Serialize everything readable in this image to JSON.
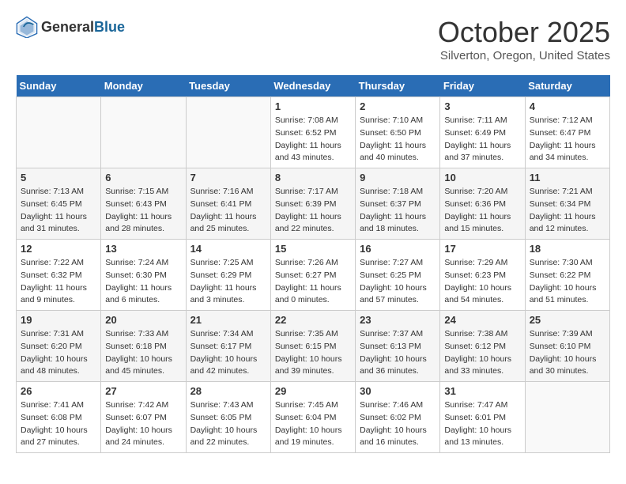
{
  "header": {
    "logo_general": "General",
    "logo_blue": "Blue",
    "title": "October 2025",
    "subtitle": "Silverton, Oregon, United States"
  },
  "days_of_week": [
    "Sunday",
    "Monday",
    "Tuesday",
    "Wednesday",
    "Thursday",
    "Friday",
    "Saturday"
  ],
  "weeks": [
    [
      {
        "day": "",
        "info": ""
      },
      {
        "day": "",
        "info": ""
      },
      {
        "day": "",
        "info": ""
      },
      {
        "day": "1",
        "info": "Sunrise: 7:08 AM\nSunset: 6:52 PM\nDaylight: 11 hours\nand 43 minutes."
      },
      {
        "day": "2",
        "info": "Sunrise: 7:10 AM\nSunset: 6:50 PM\nDaylight: 11 hours\nand 40 minutes."
      },
      {
        "day": "3",
        "info": "Sunrise: 7:11 AM\nSunset: 6:49 PM\nDaylight: 11 hours\nand 37 minutes."
      },
      {
        "day": "4",
        "info": "Sunrise: 7:12 AM\nSunset: 6:47 PM\nDaylight: 11 hours\nand 34 minutes."
      }
    ],
    [
      {
        "day": "5",
        "info": "Sunrise: 7:13 AM\nSunset: 6:45 PM\nDaylight: 11 hours\nand 31 minutes."
      },
      {
        "day": "6",
        "info": "Sunrise: 7:15 AM\nSunset: 6:43 PM\nDaylight: 11 hours\nand 28 minutes."
      },
      {
        "day": "7",
        "info": "Sunrise: 7:16 AM\nSunset: 6:41 PM\nDaylight: 11 hours\nand 25 minutes."
      },
      {
        "day": "8",
        "info": "Sunrise: 7:17 AM\nSunset: 6:39 PM\nDaylight: 11 hours\nand 22 minutes."
      },
      {
        "day": "9",
        "info": "Sunrise: 7:18 AM\nSunset: 6:37 PM\nDaylight: 11 hours\nand 18 minutes."
      },
      {
        "day": "10",
        "info": "Sunrise: 7:20 AM\nSunset: 6:36 PM\nDaylight: 11 hours\nand 15 minutes."
      },
      {
        "day": "11",
        "info": "Sunrise: 7:21 AM\nSunset: 6:34 PM\nDaylight: 11 hours\nand 12 minutes."
      }
    ],
    [
      {
        "day": "12",
        "info": "Sunrise: 7:22 AM\nSunset: 6:32 PM\nDaylight: 11 hours\nand 9 minutes."
      },
      {
        "day": "13",
        "info": "Sunrise: 7:24 AM\nSunset: 6:30 PM\nDaylight: 11 hours\nand 6 minutes."
      },
      {
        "day": "14",
        "info": "Sunrise: 7:25 AM\nSunset: 6:29 PM\nDaylight: 11 hours\nand 3 minutes."
      },
      {
        "day": "15",
        "info": "Sunrise: 7:26 AM\nSunset: 6:27 PM\nDaylight: 11 hours\nand 0 minutes."
      },
      {
        "day": "16",
        "info": "Sunrise: 7:27 AM\nSunset: 6:25 PM\nDaylight: 10 hours\nand 57 minutes."
      },
      {
        "day": "17",
        "info": "Sunrise: 7:29 AM\nSunset: 6:23 PM\nDaylight: 10 hours\nand 54 minutes."
      },
      {
        "day": "18",
        "info": "Sunrise: 7:30 AM\nSunset: 6:22 PM\nDaylight: 10 hours\nand 51 minutes."
      }
    ],
    [
      {
        "day": "19",
        "info": "Sunrise: 7:31 AM\nSunset: 6:20 PM\nDaylight: 10 hours\nand 48 minutes."
      },
      {
        "day": "20",
        "info": "Sunrise: 7:33 AM\nSunset: 6:18 PM\nDaylight: 10 hours\nand 45 minutes."
      },
      {
        "day": "21",
        "info": "Sunrise: 7:34 AM\nSunset: 6:17 PM\nDaylight: 10 hours\nand 42 minutes."
      },
      {
        "day": "22",
        "info": "Sunrise: 7:35 AM\nSunset: 6:15 PM\nDaylight: 10 hours\nand 39 minutes."
      },
      {
        "day": "23",
        "info": "Sunrise: 7:37 AM\nSunset: 6:13 PM\nDaylight: 10 hours\nand 36 minutes."
      },
      {
        "day": "24",
        "info": "Sunrise: 7:38 AM\nSunset: 6:12 PM\nDaylight: 10 hours\nand 33 minutes."
      },
      {
        "day": "25",
        "info": "Sunrise: 7:39 AM\nSunset: 6:10 PM\nDaylight: 10 hours\nand 30 minutes."
      }
    ],
    [
      {
        "day": "26",
        "info": "Sunrise: 7:41 AM\nSunset: 6:08 PM\nDaylight: 10 hours\nand 27 minutes."
      },
      {
        "day": "27",
        "info": "Sunrise: 7:42 AM\nSunset: 6:07 PM\nDaylight: 10 hours\nand 24 minutes."
      },
      {
        "day": "28",
        "info": "Sunrise: 7:43 AM\nSunset: 6:05 PM\nDaylight: 10 hours\nand 22 minutes."
      },
      {
        "day": "29",
        "info": "Sunrise: 7:45 AM\nSunset: 6:04 PM\nDaylight: 10 hours\nand 19 minutes."
      },
      {
        "day": "30",
        "info": "Sunrise: 7:46 AM\nSunset: 6:02 PM\nDaylight: 10 hours\nand 16 minutes."
      },
      {
        "day": "31",
        "info": "Sunrise: 7:47 AM\nSunset: 6:01 PM\nDaylight: 10 hours\nand 13 minutes."
      },
      {
        "day": "",
        "info": ""
      }
    ]
  ]
}
